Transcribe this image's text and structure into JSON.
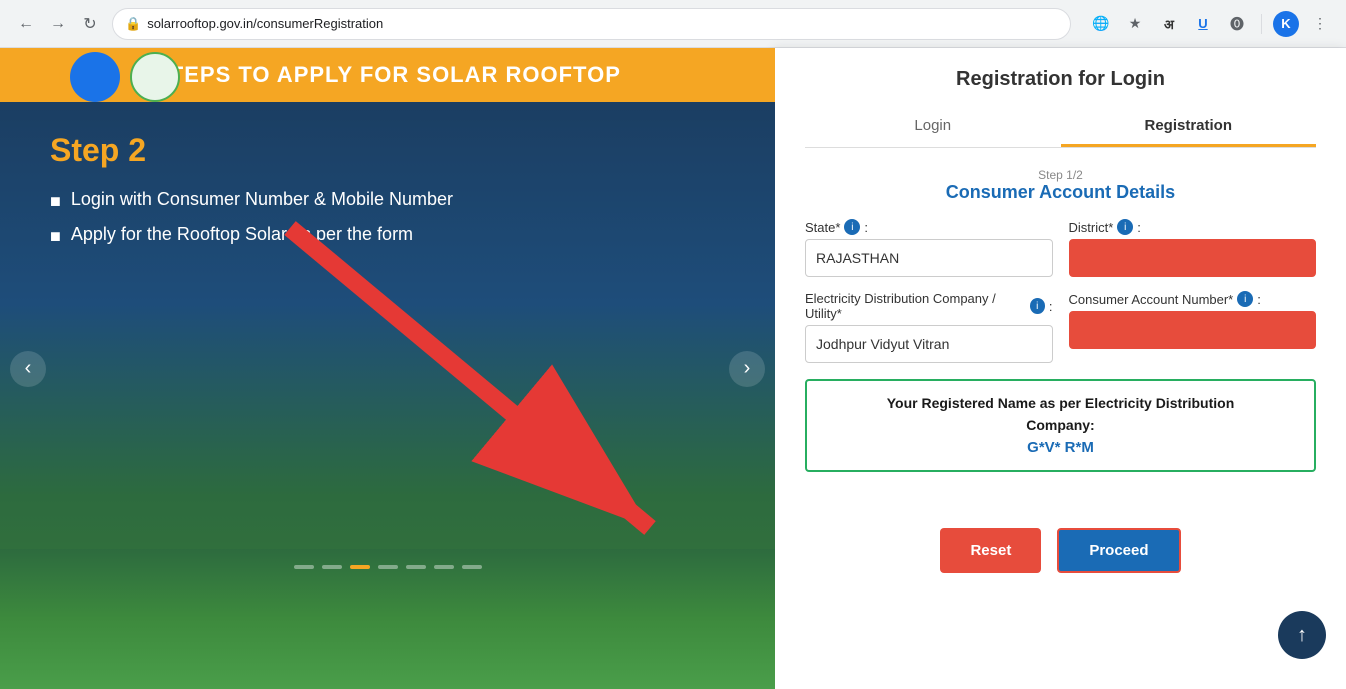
{
  "browser": {
    "url": "solarrooftop.gov.in/consumerRegistration",
    "back_disabled": false,
    "forward_disabled": false
  },
  "left_panel": {
    "header": "STEPS TO APPLY FOR SOLAR ROOFTOP",
    "step_title": "Step 2",
    "step_items": [
      "Login with Consumer Number & Mobile Number",
      "Apply for the Rooftop Solar as per the form"
    ],
    "carousel_dots": [
      false,
      false,
      true,
      false,
      false,
      false,
      false
    ],
    "prev_label": "‹",
    "next_label": "›"
  },
  "right_panel": {
    "title": "Registration for Login",
    "tabs": [
      {
        "id": "login",
        "label": "Login",
        "active": false
      },
      {
        "id": "registration",
        "label": "Registration",
        "active": true
      }
    ],
    "step_indicator": {
      "step_num": "Step 1/2",
      "step_label": "Consumer Account Details"
    },
    "fields": {
      "state_label": "State*",
      "state_value": "RAJASTHAN",
      "district_label": "District*",
      "district_value": "",
      "electricity_label": "Electricity Distribution Company / Utility*",
      "electricity_value": "Jodhpur Vidyut Vitran",
      "consumer_account_label": "Consumer Account Number*",
      "consumer_account_value": ""
    },
    "info_box": {
      "line1": "Your Registered Name as per Electricity Distribution",
      "line2": "Company:",
      "value": "G*V* R*M"
    },
    "buttons": {
      "reset": "Reset",
      "proceed": "Proceed"
    }
  },
  "scroll_top_icon": "↑"
}
